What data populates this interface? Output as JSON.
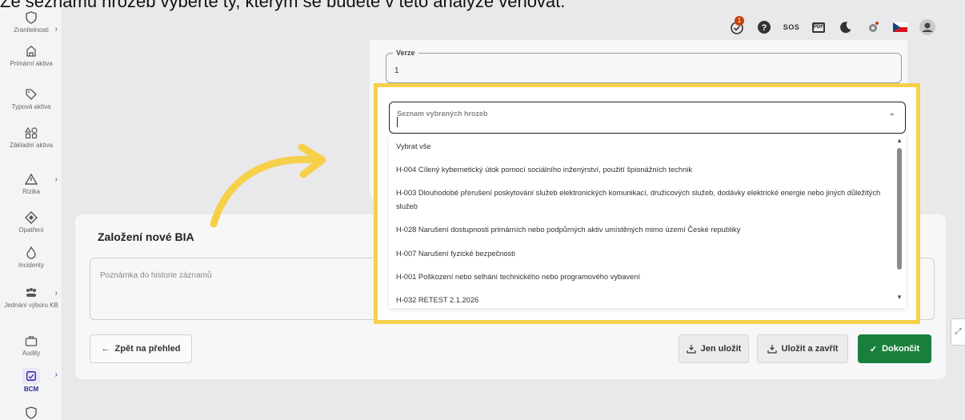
{
  "caption": "Ze seznamu hrozeb vyberte ty, kterým se budete v této analýze věnovat.",
  "sidebar": {
    "items": [
      {
        "label": "Zranitelnosti",
        "icon": "shield-icon"
      },
      {
        "label": "Primární aktiva",
        "icon": "building-icon"
      },
      {
        "label": "Typová aktiva",
        "icon": "tag-icon"
      },
      {
        "label": "Základní aktiva",
        "icon": "shapes-icon"
      },
      {
        "label": "Rizika",
        "icon": "warning-icon"
      },
      {
        "label": "Opatření",
        "icon": "diamond-icon"
      },
      {
        "label": "Incidenty",
        "icon": "fire-icon"
      },
      {
        "label": "Jednání výboru KB",
        "icon": "group-icon"
      },
      {
        "label": "Audity",
        "icon": "briefcase-icon"
      },
      {
        "label": "BCM",
        "icon": "bcm-icon"
      }
    ]
  },
  "topbar": {
    "notification_count": "1",
    "sos": "SOS",
    "pdf": "PDF"
  },
  "form": {
    "verze_label": "Verze",
    "verze_value": "1"
  },
  "threat_select": {
    "placeholder": "Seznam vybraných hrozeb",
    "options": [
      "Vybrat vše",
      "H-004 Cílený kybernetický útok pomocí sociálního inženýrství, použití špionážních technik",
      "H-003 Dlouhodobé přerušení poskytování služeb elektronických komunikací, družicových služeb, dodávky elektrické energie nebo jiných důležitých služeb",
      "H-028 Narušení dostupnosti primárních nebo podpůrných aktiv umístěných mimo území České republiky",
      "H-007 Narušení fyzické bezpečnosti",
      "H-001 Poškození nebo selhání technického nebo programového vybavení",
      "H-032 RETEST 2.1.2026"
    ]
  },
  "bia": {
    "title": "Založení nové BIA",
    "note_placeholder": "Poznámka do historie záznamů",
    "back_label": "Zpět na přehled",
    "save_label": "Jen uložit",
    "save_close_label": "Uložit a zavřít",
    "finish_label": "Dokončit"
  },
  "colors": {
    "highlight": "#f7d04a",
    "finish_button": "#1a7f3c",
    "arrow": "#f7d04a"
  }
}
